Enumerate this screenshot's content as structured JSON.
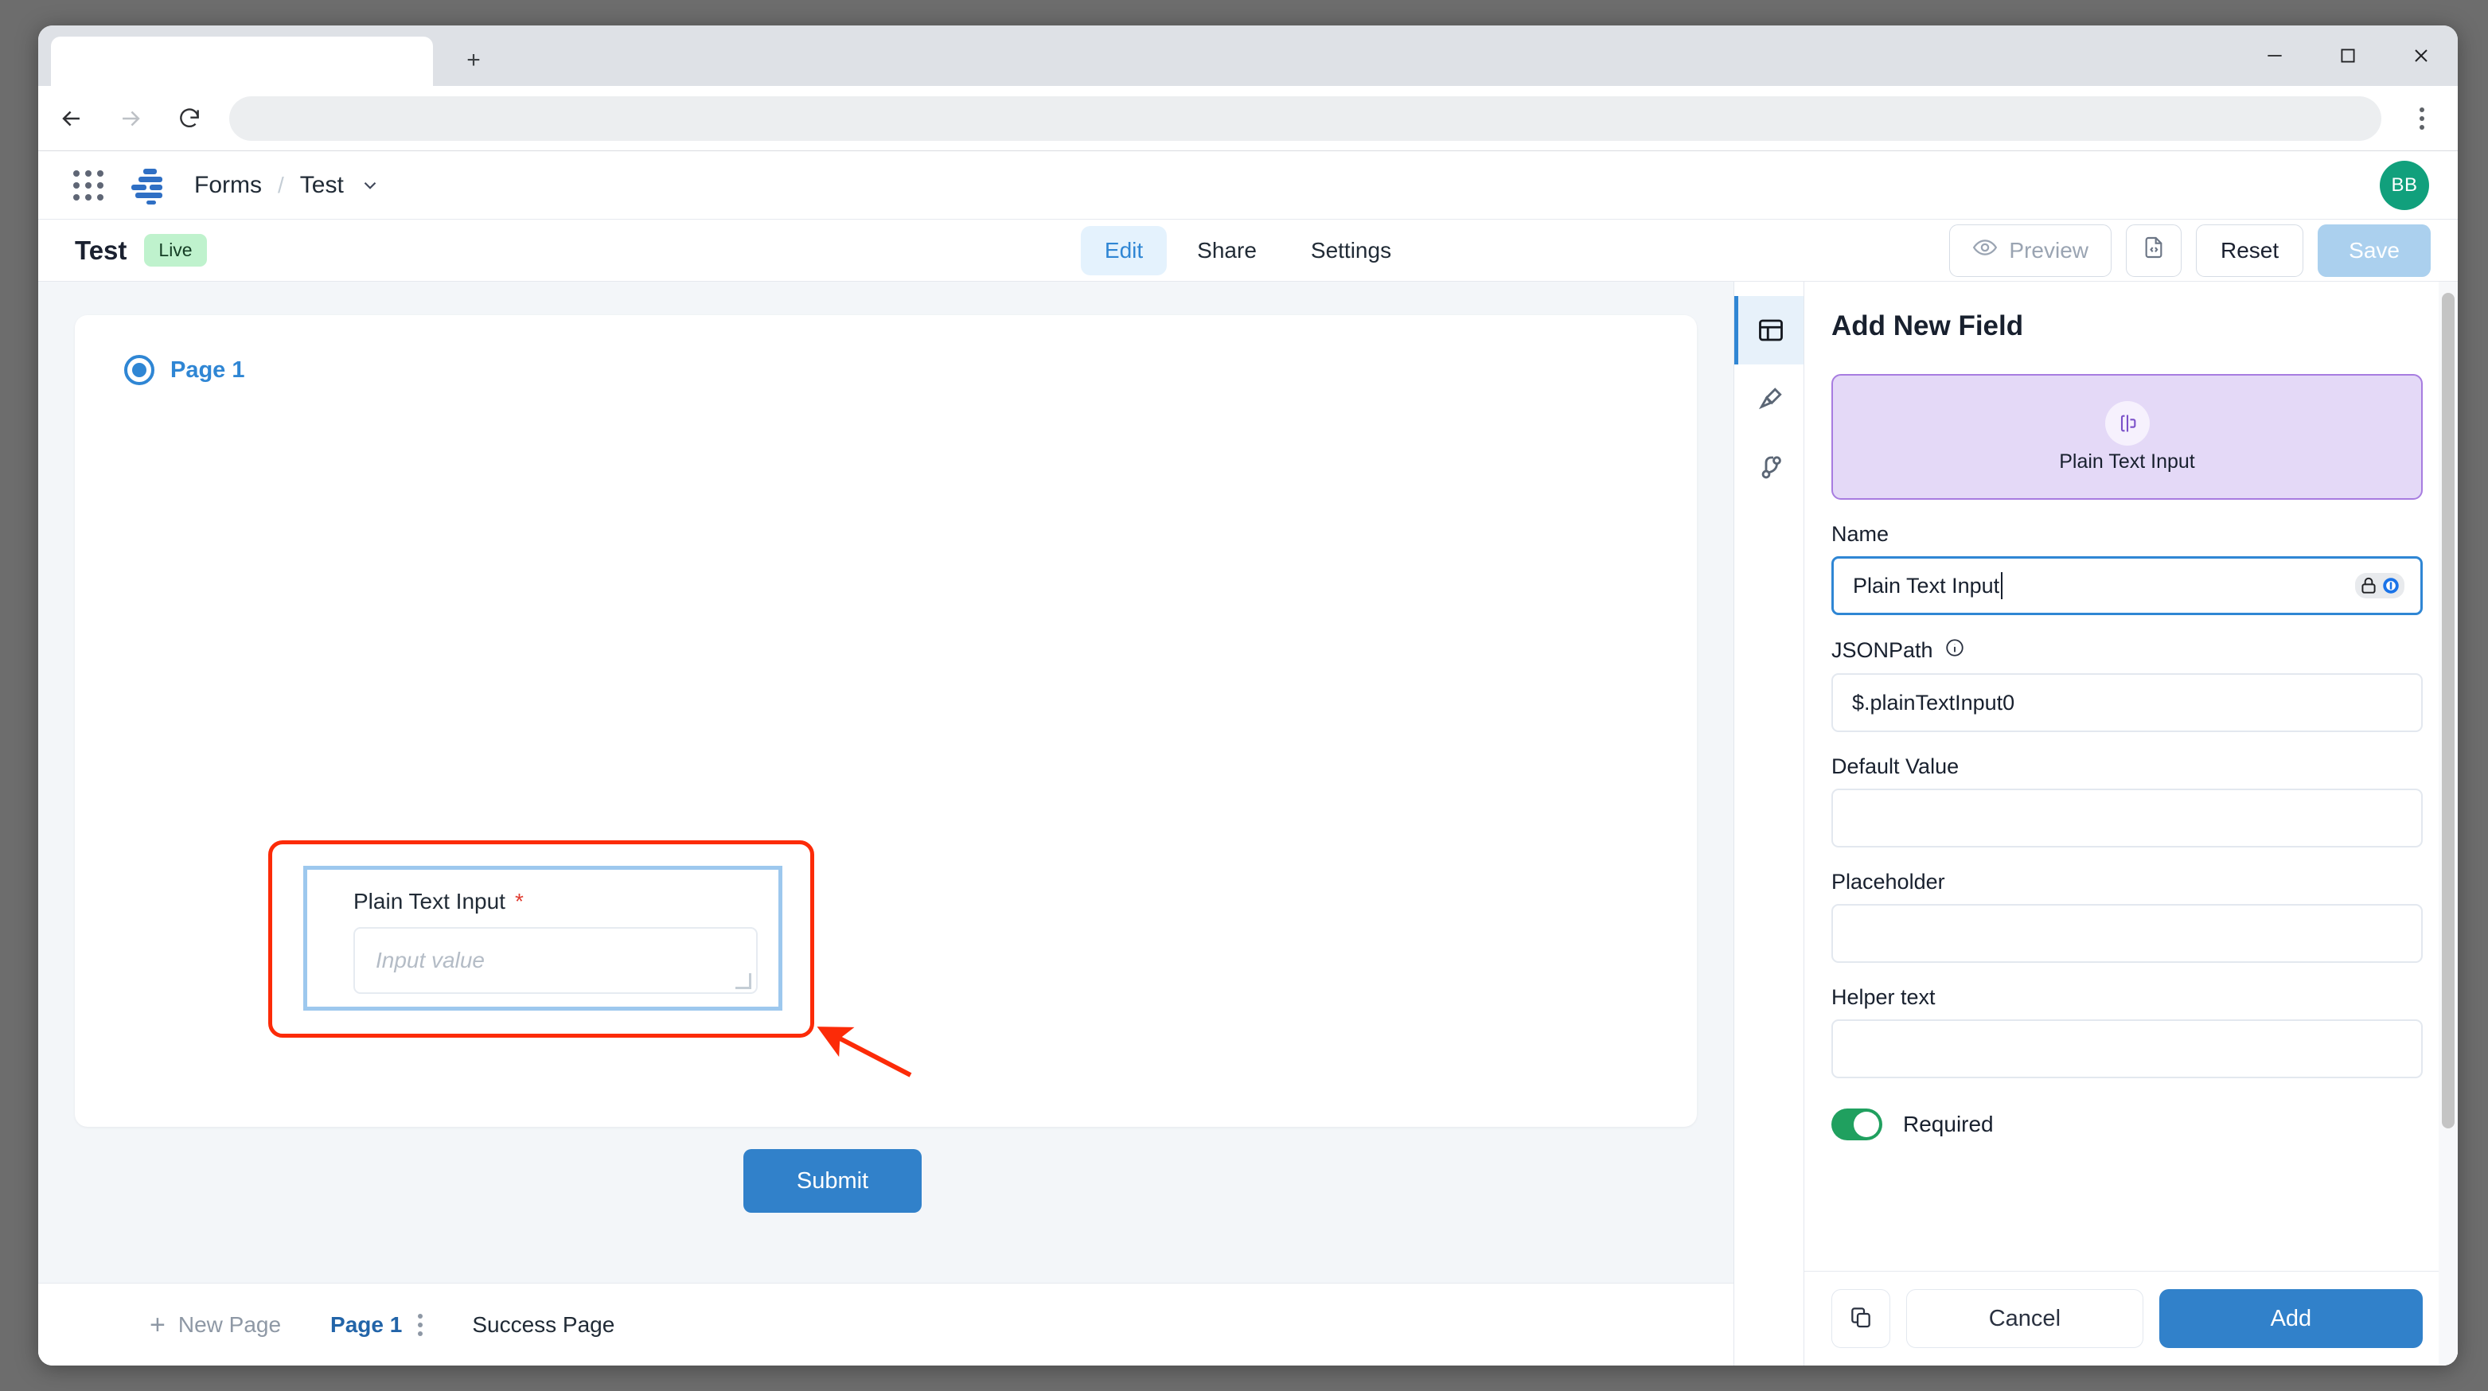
{
  "browser": {
    "tab_title": "",
    "address_value": "",
    "new_tab_label": "+",
    "minimize_label": "Minimize",
    "maximize_label": "Maximize",
    "close_label": "Close"
  },
  "app_header": {
    "breadcrumb_root": "Forms",
    "breadcrumb_sep": "/",
    "breadcrumb_current": "Test",
    "avatar_initials": "BB"
  },
  "sub_header": {
    "form_title": "Test",
    "status_badge": "Live",
    "tabs": [
      {
        "label": "Edit",
        "active": true
      },
      {
        "label": "Share",
        "active": false
      },
      {
        "label": "Settings",
        "active": false
      }
    ],
    "preview_label": "Preview",
    "reset_label": "Reset",
    "save_label": "Save"
  },
  "canvas": {
    "page_label": "Page 1",
    "field": {
      "label": "Plain Text Input",
      "required_mark": "*",
      "placeholder": "Input value",
      "value": ""
    },
    "submit_label": "Submit"
  },
  "bottom_bar": {
    "new_page_label": "New Page",
    "new_page_plus": "+",
    "page_tab": "Page 1",
    "success_page": "Success Page"
  },
  "panel": {
    "title": "Add New Field",
    "type_card_label": "Plain Text Input",
    "name_label": "Name",
    "name_value": "Plain Text Input",
    "jsonpath_label": "JSONPath",
    "jsonpath_value": "$.plainTextInput0",
    "default_value_label": "Default Value",
    "default_value": "",
    "placeholder_label": "Placeholder",
    "placeholder_value": "",
    "helper_text_label": "Helper text",
    "helper_text_value": "",
    "required_label": "Required",
    "required_on": true,
    "cancel_label": "Cancel",
    "add_label": "Add"
  },
  "colors": {
    "accent_blue": "#3181ca",
    "tab_active_bg": "#e4f2fd",
    "badge_green": "#bff2cd",
    "purple_card": "#e4d9f7",
    "purple_border": "#a77ce0",
    "toggle_green": "#20a05f",
    "annotation_red": "#fc2b08",
    "avatar_green": "#11a07c",
    "save_disabled": "#abd0ee"
  }
}
